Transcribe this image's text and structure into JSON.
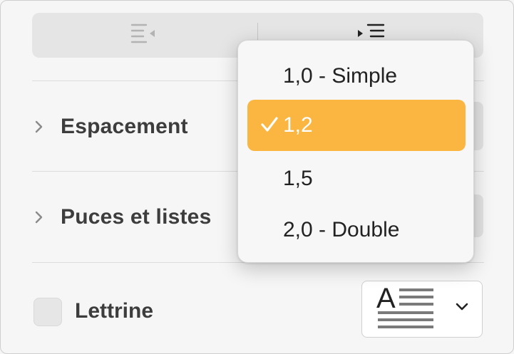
{
  "toolbar": {
    "indent_left_icon": "decrease-indent-icon",
    "indent_right_icon": "increase-indent-icon"
  },
  "sections": {
    "spacing_label": "Espacement",
    "bullets_label": "Puces et listes"
  },
  "popup": {
    "items": [
      {
        "label": "1,0 - Simple",
        "selected": false
      },
      {
        "label": "1,2",
        "selected": true
      },
      {
        "label": "1,5",
        "selected": false
      },
      {
        "label": "2,0 - Double",
        "selected": false
      }
    ],
    "selection_color": "#fbb541"
  },
  "dropcap": {
    "label": "Lettrine",
    "checked": false,
    "preview_letter": "A",
    "chevron_icon": "chevron-down-icon"
  }
}
